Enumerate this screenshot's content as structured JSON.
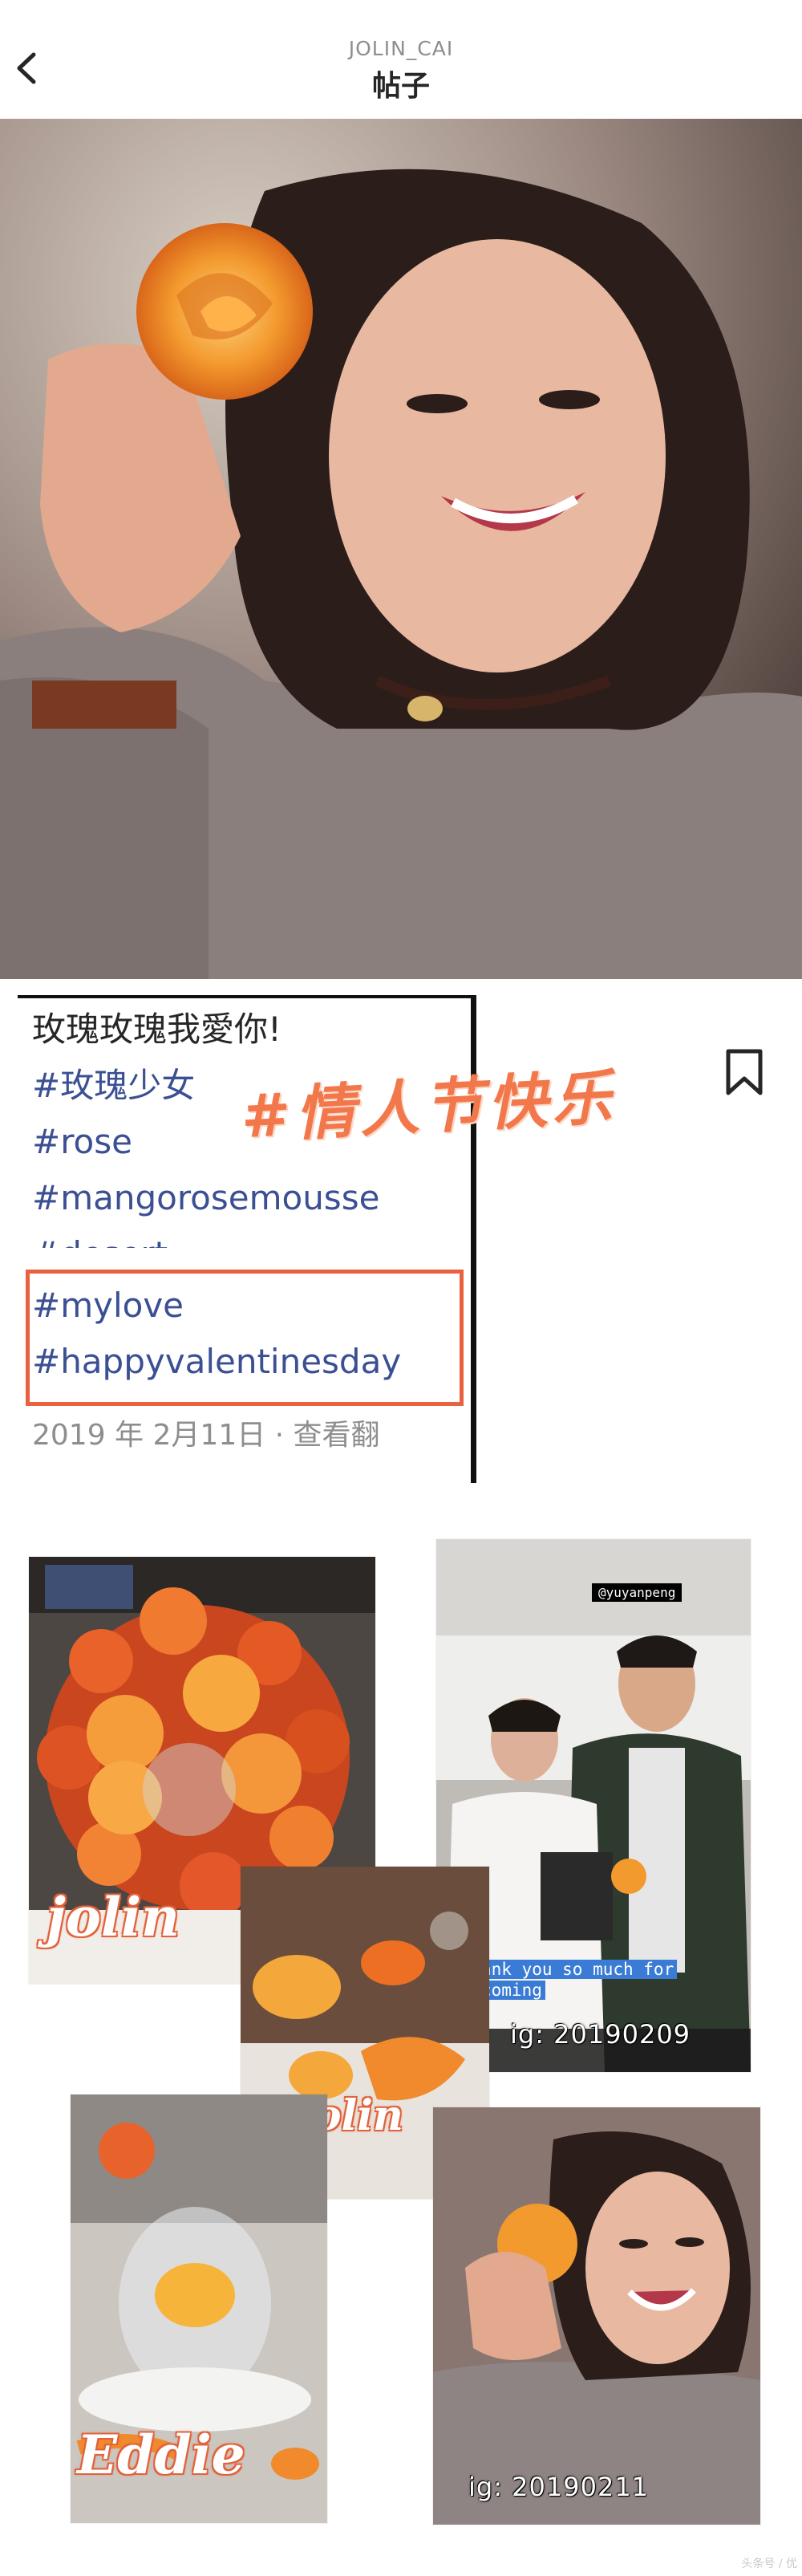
{
  "header": {
    "username": "JOLIN_CAI",
    "title": "帖子"
  },
  "caption": {
    "line1": "玫瑰玫瑰我愛你!",
    "tags": [
      "#玫瑰少女",
      "#rose",
      "#mangorosemousse",
      "#desert",
      "#mylove",
      "#happyvalentinesday"
    ],
    "date_text": "2019 年 2月11日 · 查看翻"
  },
  "overlay": {
    "chinese_tag": "#情人节快乐"
  },
  "collage": {
    "label_jolin_1": "jolin",
    "label_jolin_2": "jolin",
    "label_eddie": "Eddie",
    "handle_tag": "@yuyanpeng",
    "story_line1": "ank you so much for",
    "story_line2": "coming",
    "ig_1": "ig: 20190209",
    "ig_2": "ig: 20190211"
  },
  "watermark": "头条号 / 优",
  "colors": {
    "accent_orange": "#f2784c",
    "highlight_red": "#e9613f",
    "hashtag_blue": "#3b4f93",
    "rose_orange": "#f08a2c"
  },
  "icons": [
    "back-arrow-icon",
    "bookmark-icon"
  ]
}
